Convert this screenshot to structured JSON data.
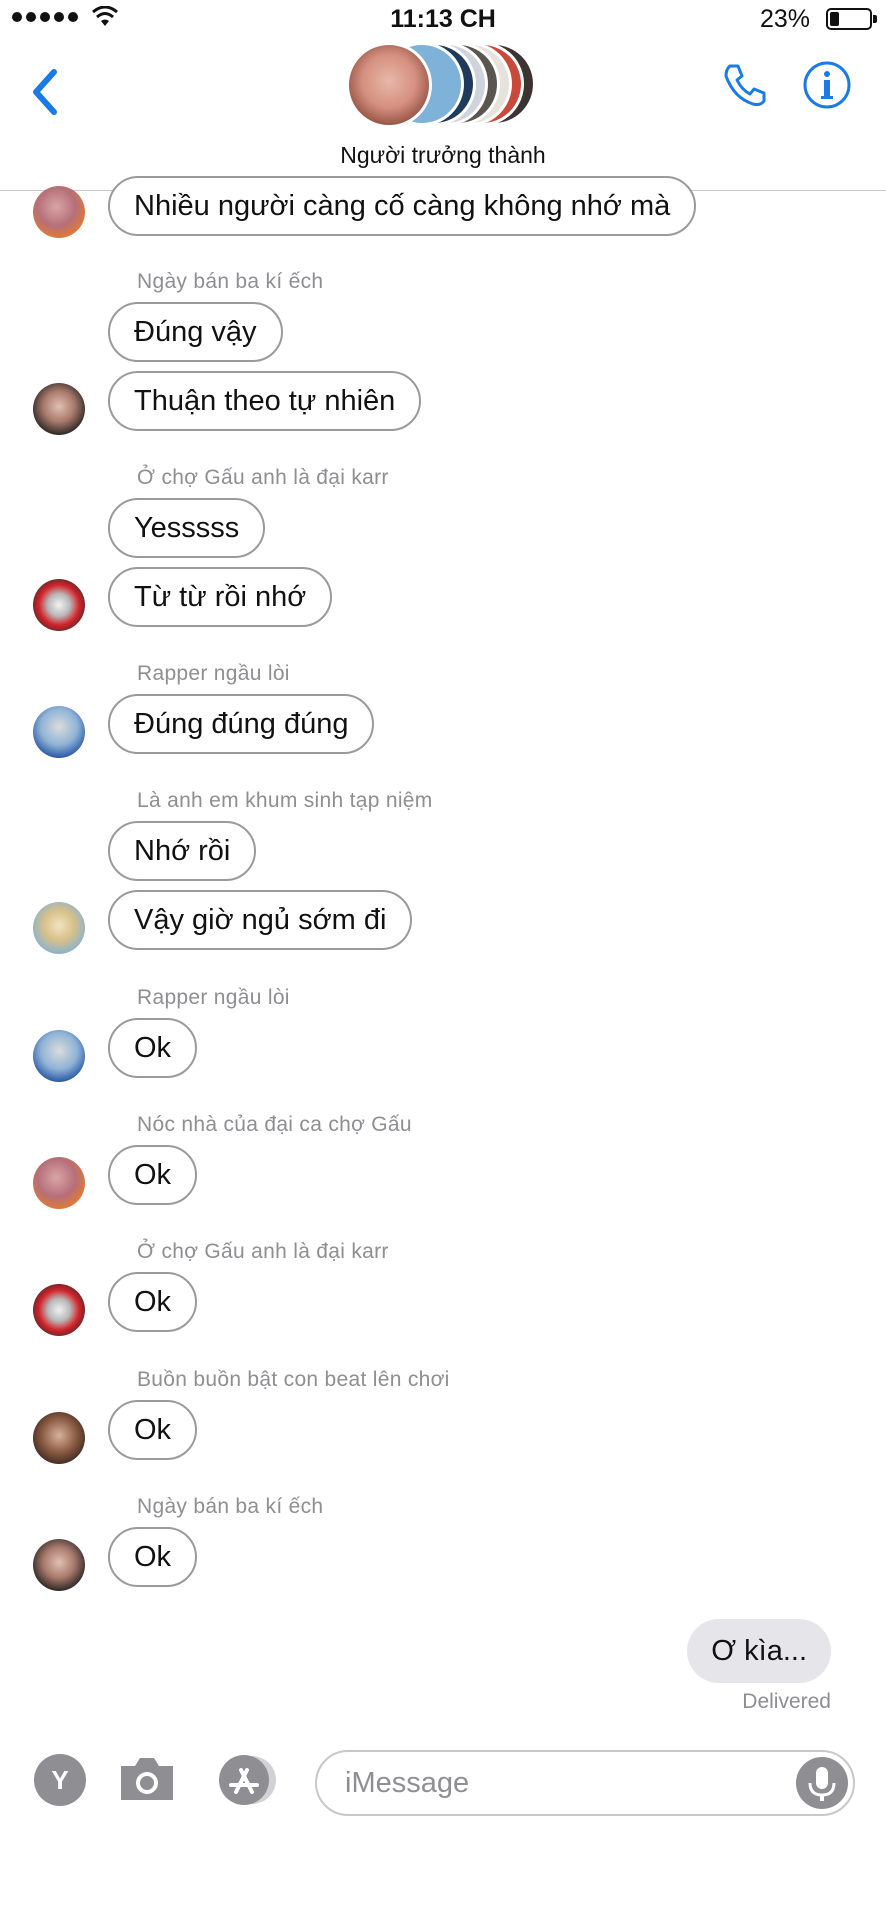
{
  "status_bar": {
    "time": "11:13 CH",
    "battery_percent": "23%",
    "battery_level": 0.23
  },
  "header": {
    "group_name": "Người trưởng thành"
  },
  "messages": [
    {
      "sender": "",
      "text": "Nhiều người càng cố càng không nhớ mà"
    },
    {
      "sender": "Ngày bán ba kí ếch",
      "texts": [
        "Đúng vậy",
        "Thuận theo tự nhiên"
      ]
    },
    {
      "sender": "Ở chợ Gấu anh là đại karr",
      "texts": [
        "Yesssss",
        "Từ từ rồi nhớ"
      ]
    },
    {
      "sender": "Rapper ngầu lòi",
      "texts": [
        "Đúng đúng đúng"
      ]
    },
    {
      "sender": "Là anh em khum sinh tạp niệm",
      "texts": [
        "Nhớ rồi",
        "Vậy giờ ngủ sớm đi"
      ]
    },
    {
      "sender": "Rapper ngầu lòi",
      "texts": [
        "Ok"
      ]
    },
    {
      "sender": "Nóc nhà của đại ca chợ Gấu",
      "texts": [
        "Ok"
      ]
    },
    {
      "sender": "Ở chợ Gấu anh là đại karr",
      "texts": [
        "Ok"
      ]
    },
    {
      "sender": "Buồn buồn bật con beat lên chơi",
      "texts": [
        "Ok"
      ]
    },
    {
      "sender": "Ngày bán ba kí ếch",
      "texts": [
        "Ok"
      ]
    }
  ],
  "my_message": {
    "text": "Ơ kìa...",
    "status": "Delivered"
  },
  "input": {
    "placeholder": "iMessage",
    "left_button": "Y"
  },
  "colors": {
    "accent": "#1a7be6",
    "bubble_mine": "#e5e5ea",
    "meta_gray": "#8e8e93"
  }
}
